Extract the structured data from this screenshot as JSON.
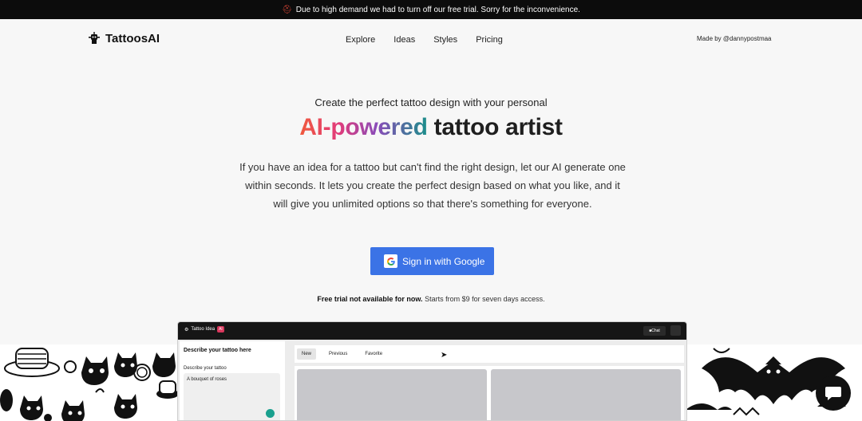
{
  "banner": {
    "emoji": "⛑",
    "text": "Due to high demand we had to turn off our free trial. Sorry for the inconvenience."
  },
  "nav": {
    "logo_text": "TattoosAI",
    "links": [
      "Explore",
      "Ideas",
      "Styles",
      "Pricing"
    ],
    "made_by": "Made by @dannypostmaa"
  },
  "hero": {
    "subtitle": "Create the perfect tattoo design with your personal",
    "title_gradient": "AI-powered",
    "title_rest": " tattoo artist",
    "description": "If you have an idea for a tattoo but can't find the right design, let our AI generate one within seconds. It lets you create the perfect design based on what you like, and it will give you unlimited options so that there's something for everyone.",
    "signin_label": "Sign in with Google",
    "trial_bold": "Free trial not available for now.",
    "trial_rest": " Starts from $9 for seven days access."
  },
  "app_preview": {
    "logo_text": "Tattoo Idea",
    "logo_badge": "AI",
    "chat_label": "Chat",
    "side_heading": "Describe your tattoo here",
    "side_label": "Describe your tattoo",
    "side_value": "A bouquet of roses",
    "tabs": [
      "New",
      "Previous",
      "Favorite"
    ]
  },
  "colors": {
    "banner_bg": "#0c0c0c",
    "button_blue": "#3b73e6",
    "gradient_start": "#f05a3c",
    "gradient_end": "#1a8f8a"
  }
}
